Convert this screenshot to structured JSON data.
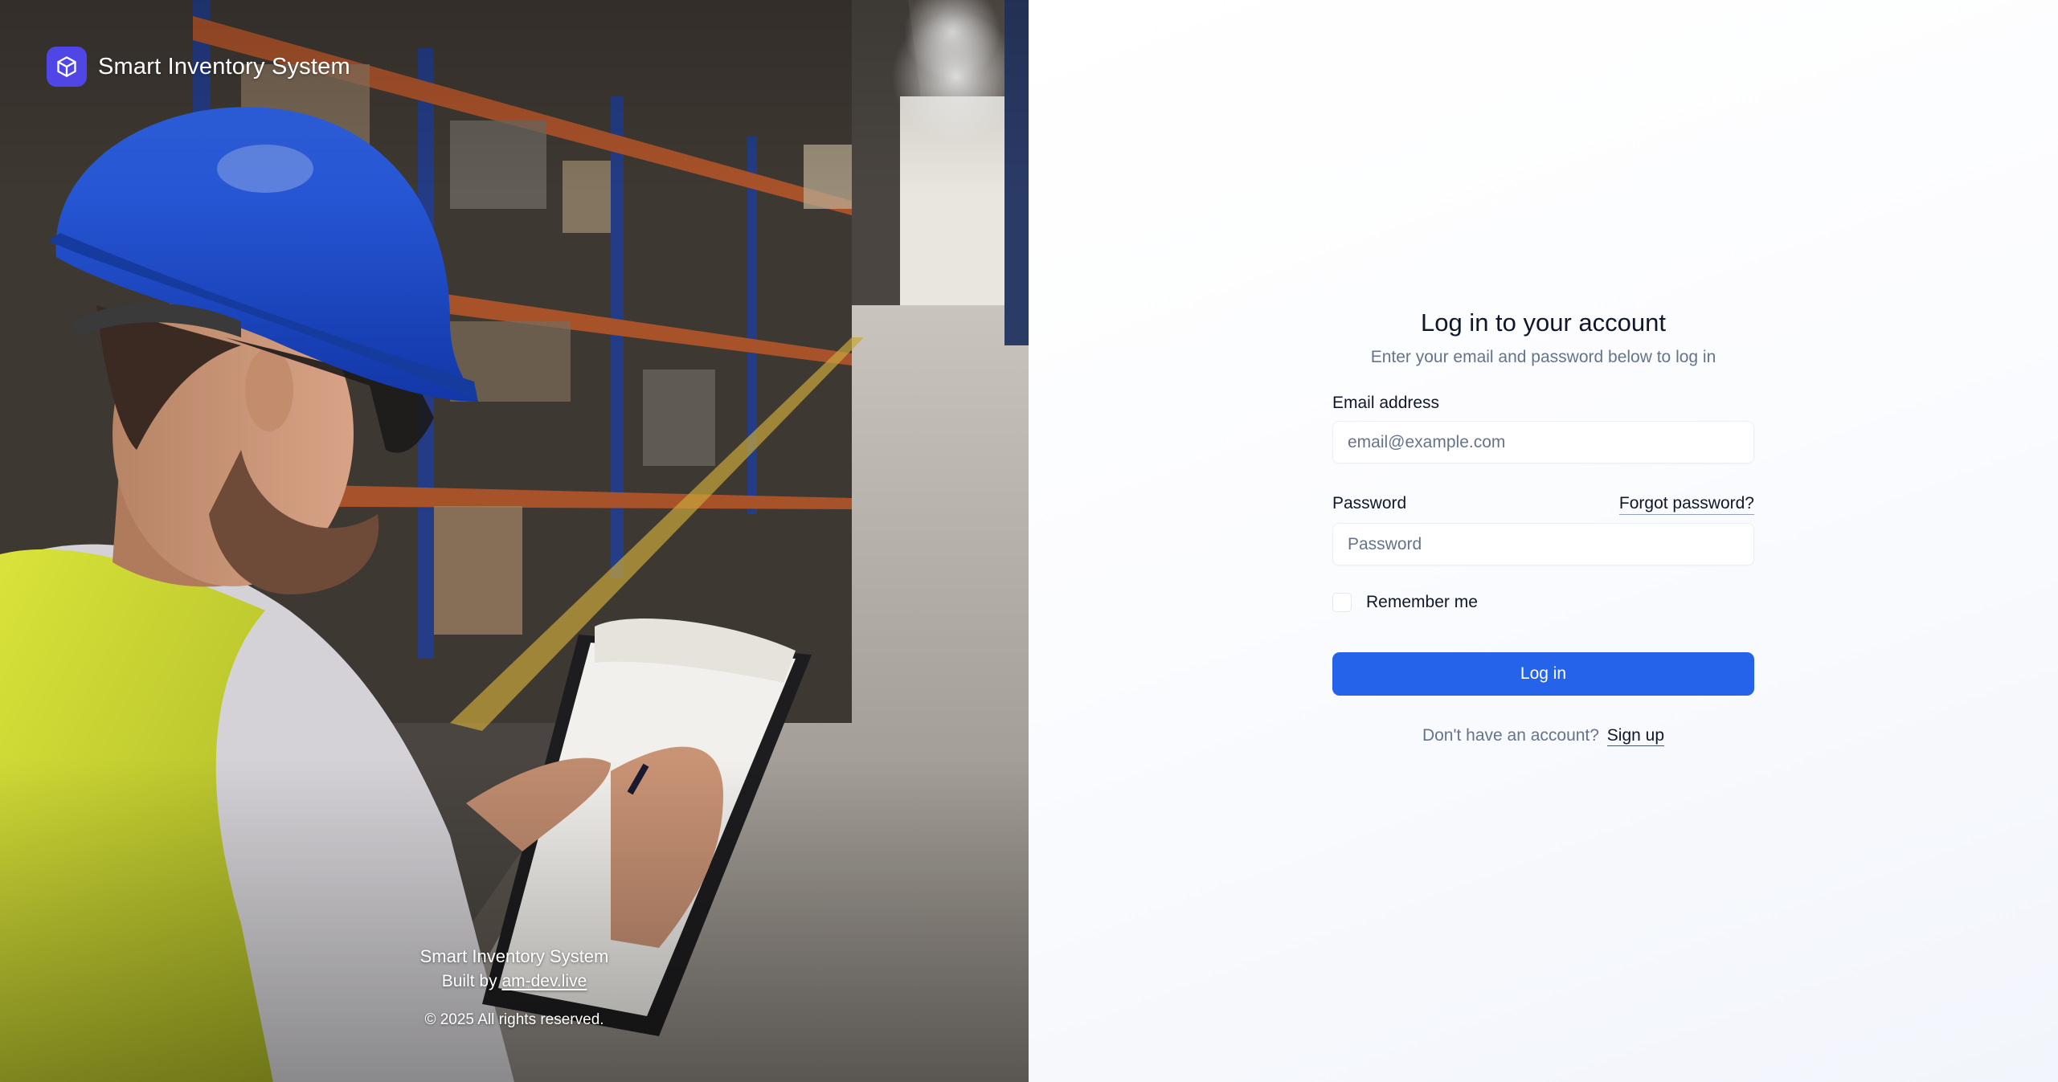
{
  "brand": {
    "name": "Smart Inventory System",
    "logo_icon": "cube-icon",
    "accent_color": "#4f46e5"
  },
  "hero": {
    "image": "warehouse-worker-photo",
    "footer": {
      "app_name": "Smart Inventory System",
      "built_by_prefix": "Built by",
      "built_by_link": "am-dev.live",
      "copyright": "© 2025 All rights reserved."
    }
  },
  "login": {
    "title": "Log in to your account",
    "subtitle": "Enter your email and password below to log in",
    "email": {
      "label": "Email address",
      "value": "",
      "placeholder": "email@example.com"
    },
    "password": {
      "label": "Password",
      "value": "",
      "placeholder": "Password",
      "forgot_link": "Forgot password?"
    },
    "remember": {
      "label": "Remember me",
      "checked": false
    },
    "submit_label": "Log in",
    "signup": {
      "prompt": "Don't have an account?",
      "link": "Sign up"
    },
    "button_color": "#2563eb"
  }
}
